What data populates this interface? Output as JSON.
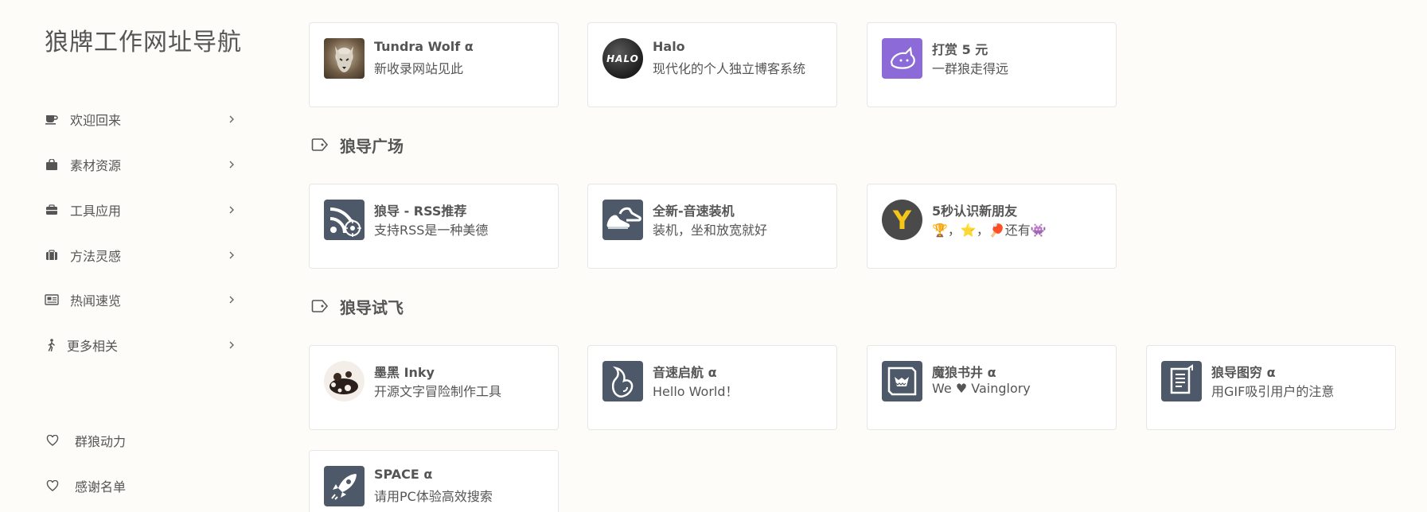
{
  "sidebar": {
    "logo": "狼牌工作网址导航",
    "items": [
      {
        "label": "欢迎回来"
      },
      {
        "label": "素材资源"
      },
      {
        "label": "工具应用"
      },
      {
        "label": "方法灵感"
      },
      {
        "label": "热闻速览"
      },
      {
        "label": "更多相关"
      }
    ],
    "footer": [
      {
        "label": "群狼动力"
      },
      {
        "label": "感谢名单"
      }
    ]
  },
  "top_cards": [
    {
      "title": "Tundra Wolf α",
      "desc": "新收录网站见此"
    },
    {
      "title": "Halo",
      "desc": "现代化的个人独立博客系统",
      "thumb_text": "HALO"
    },
    {
      "title": "打赏 5 元",
      "desc": "一群狼走得远"
    }
  ],
  "sections": [
    {
      "title": "狼导广场",
      "cards": [
        {
          "title": "狼导 - RSS推荐",
          "desc": "支持RSS是一种美德"
        },
        {
          "title": "全新-音速装机",
          "desc": "装机，坐和放宽就好"
        },
        {
          "title": "5秒认识新朋友",
          "desc": "🏆，⭐，🏓还有👾",
          "thumb_text": "Y"
        }
      ]
    },
    {
      "title": "狼导试飞",
      "cards": [
        {
          "title": "墨黑 Inky",
          "desc": "开源文字冒险制作工具"
        },
        {
          "title": "音速启航 α",
          "desc": "Hello World！"
        },
        {
          "title": "魔狼书井 α",
          "desc": "We ♥ Vainglory"
        },
        {
          "title": "狼导图穷 α",
          "desc": "用GIF吸引用户的注意"
        },
        {
          "title": "SPACE α",
          "desc": "请用PC体验高效搜索"
        }
      ]
    }
  ],
  "colors": {
    "background": "#fdfcf8",
    "card": "#ffffff",
    "card_border": "#e6e6e6",
    "text": "#555555",
    "thumb_dark": "#4d5968",
    "purple": "#8c6ad8",
    "yellow": "#f5c518"
  }
}
